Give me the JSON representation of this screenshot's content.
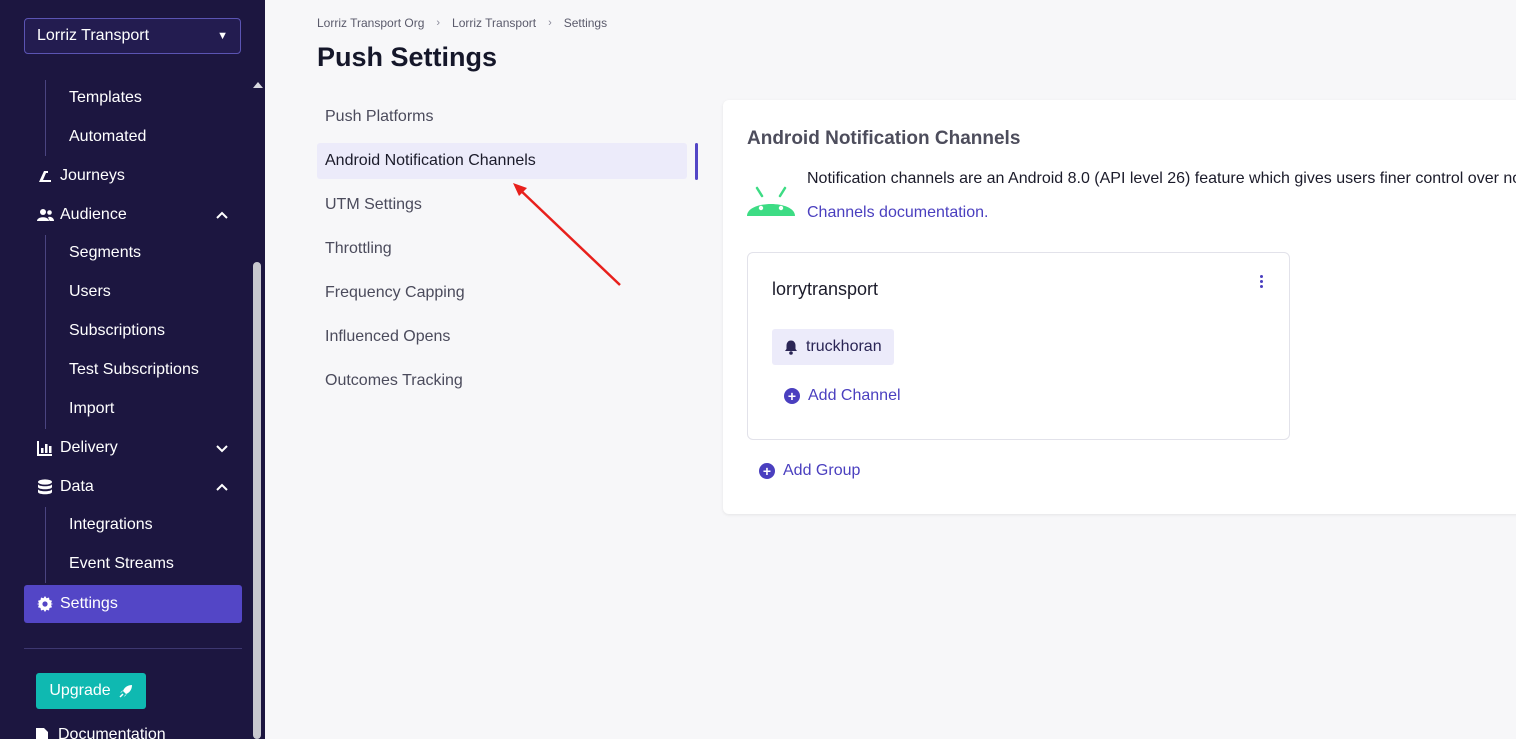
{
  "sidebar": {
    "org_selector": "Lorriz Transport",
    "items": {
      "templates": "Templates",
      "automated": "Automated",
      "journeys": "Journeys",
      "audience": "Audience",
      "segments": "Segments",
      "users": "Users",
      "subscriptions": "Subscriptions",
      "test_subscriptions": "Test Subscriptions",
      "import": "Import",
      "delivery": "Delivery",
      "data": "Data",
      "integrations": "Integrations",
      "event_streams": "Event Streams",
      "settings": "Settings"
    },
    "upgrade_label": "Upgrade",
    "documentation_label": "Documentation"
  },
  "breadcrumb": [
    "Lorriz Transport Org",
    "Lorriz Transport",
    "Settings"
  ],
  "page_title": "Push Settings",
  "sub_nav": [
    "Push Platforms",
    "Android Notification Channels",
    "UTM Settings",
    "Throttling",
    "Frequency Capping",
    "Influenced Opens",
    "Outcomes Tracking"
  ],
  "card": {
    "title": "Android Notification Channels",
    "description": "Notification channels are an Android 8.0 (API level 26) feature which gives users finer control over no",
    "doc_link": "Channels documentation.",
    "group": {
      "name": "lorrytransport",
      "channel": "truckhoran",
      "add_channel": "Add Channel"
    },
    "add_group": "Add Group"
  },
  "colors": {
    "sidebar_bg": "#1c1640",
    "accent": "#5346c6",
    "link": "#4a3fbf",
    "upgrade": "#0fb9b1",
    "android_green": "#3ddc84",
    "annotation_arrow": "#e8201c"
  }
}
